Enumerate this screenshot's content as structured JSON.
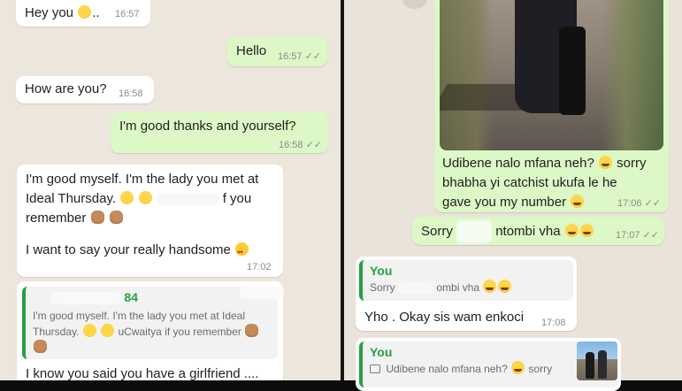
{
  "left_panel": {
    "messages": [
      {
        "type": "in",
        "text": "Hey you",
        "suffix": "..",
        "time": "16:57"
      },
      {
        "type": "out",
        "text": "Hello",
        "time": "16:57"
      },
      {
        "type": "in",
        "text": "How are you?",
        "time": "16:58"
      },
      {
        "type": "out",
        "text": "I'm good thanks and yourself?",
        "time": "16:58"
      },
      {
        "type": "in",
        "line1": "I'm good myself. I'm the lady you met at",
        "line2a": "Ideal Thursday.",
        "line2b": "f you",
        "line3": "remember",
        "line4": "I want to say your really handsome",
        "time": "17:02"
      },
      {
        "type": "in-reply",
        "quote_name": "84",
        "quote_line1": "I'm good myself. I'm the lady you met at Ideal",
        "quote_line2a": "Thursday.",
        "quote_line2b": "uCwaitya if you remember",
        "text": "I know you said you have a girlfriend ...."
      }
    ]
  },
  "right_panel": {
    "messages": [
      {
        "type": "out-image",
        "caption_line1a": "Udibene nalo mfana neh?",
        "caption_line1b": "sorry",
        "caption_line2": "bhabha yi catchist ukufa le he",
        "caption_line3": "gave you my number",
        "time": "17:06"
      },
      {
        "type": "out",
        "text_a": "Sorry",
        "text_b": "ntombi vha",
        "time": "17:07"
      },
      {
        "type": "in-reply",
        "quote_name": "You",
        "quote_text_a": "Sorry",
        "quote_text_b": "ombi vha",
        "text": "Yho . Okay sis wam enkoci",
        "time": "17:08"
      },
      {
        "type": "in-reply",
        "quote_name": "You",
        "quote_text_a": "Udibene nalo mfana neh?",
        "quote_text_b": "sorry"
      }
    ]
  },
  "colors": {
    "incoming": "#ffffff",
    "outgoing": "#dcf8c6",
    "quote_accent": "#25a244",
    "background": "#ece6dd"
  },
  "icons": [
    "pleading-face-icon",
    "monkey-see-no-evil-icon",
    "heart-eyes-icon",
    "laughing-tears-icon",
    "double-check-icon",
    "camera-icon"
  ]
}
